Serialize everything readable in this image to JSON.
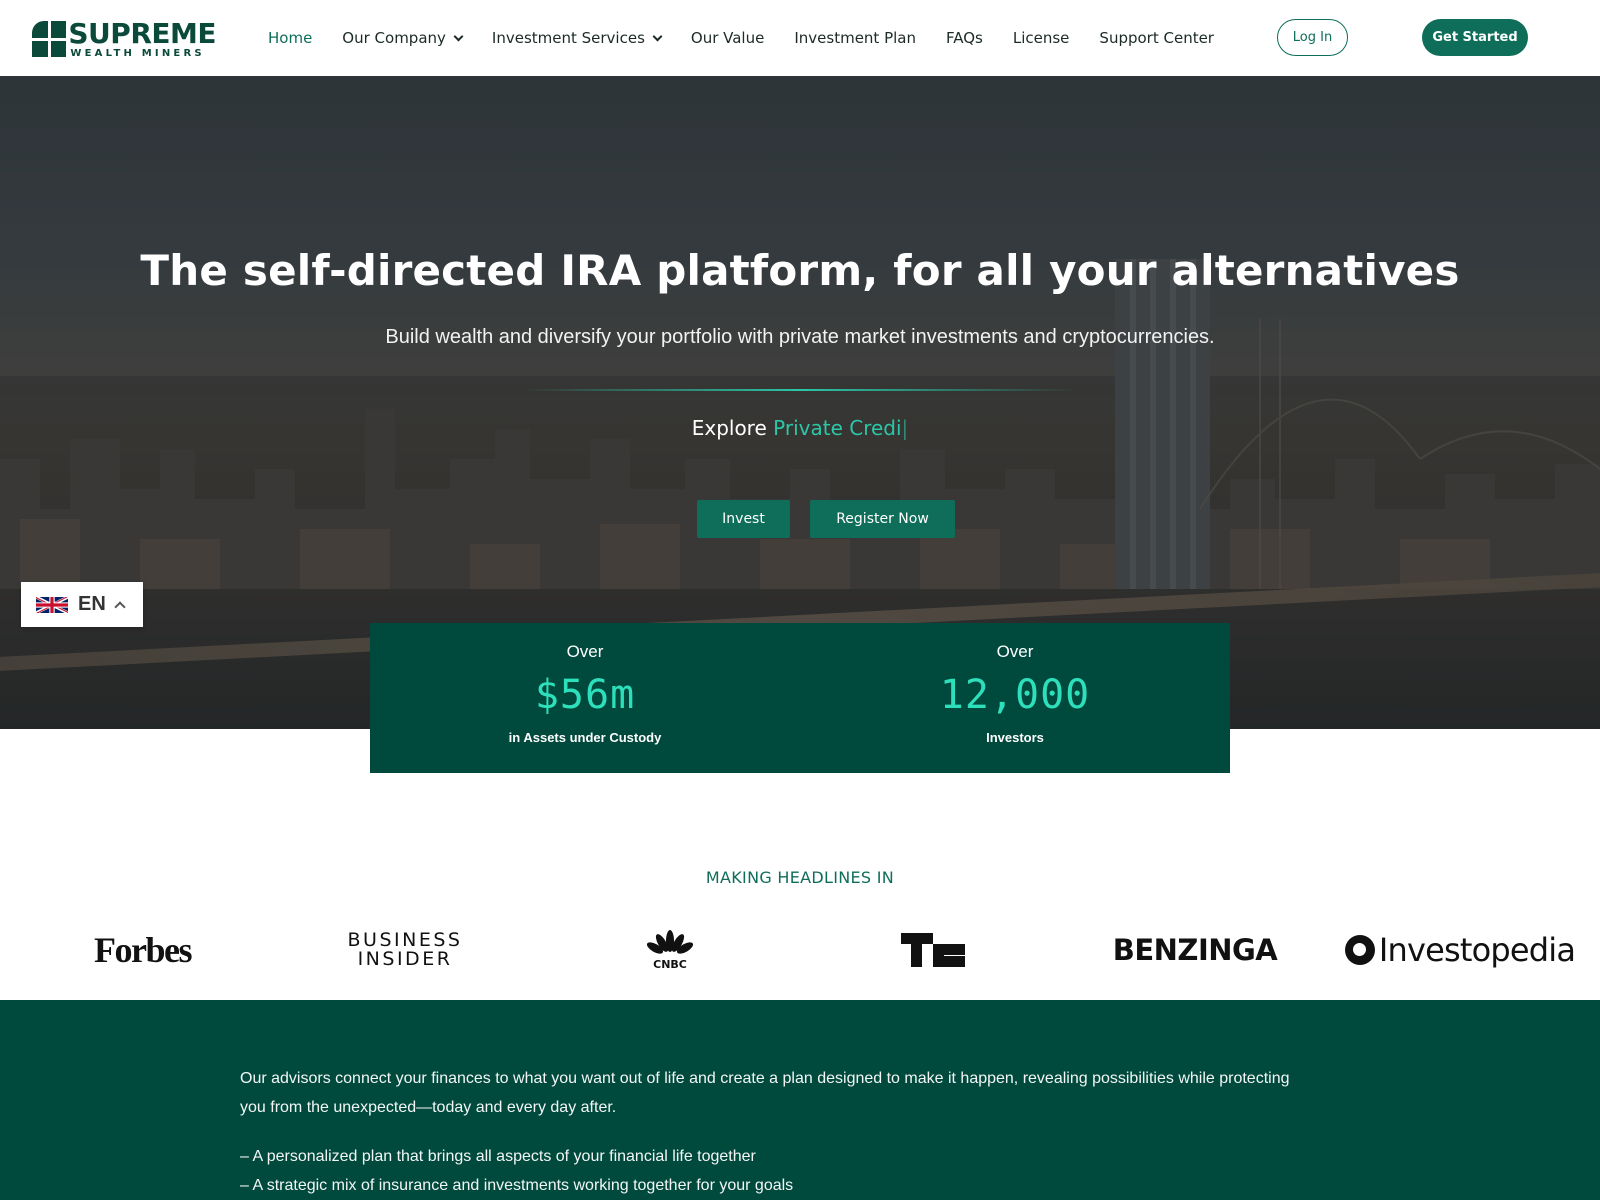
{
  "brand": {
    "name": "SUPREME",
    "tagline": "WEALTH MINERS",
    "primary_color": "#0e6e5a",
    "dark_color": "#004a3d",
    "accent_color": "#2de0bb"
  },
  "nav": {
    "items": [
      {
        "label": "Home",
        "active": true
      },
      {
        "label": "Our Company",
        "dropdown": true
      },
      {
        "label": "Investment Services",
        "dropdown": true
      },
      {
        "label": "Our Value"
      },
      {
        "label": "Investment Plan"
      },
      {
        "label": "FAQs"
      },
      {
        "label": "License"
      },
      {
        "label": "Support Center"
      }
    ],
    "login_label": "Log In",
    "cta_label": "Get Started"
  },
  "hero": {
    "title": "The self-directed IRA platform, for all your alternatives",
    "subtitle": "Build wealth and diversify your portfolio with private market investments and cryptocurrencies.",
    "explore_prefix": "Explore",
    "explore_typed": "Private Credi",
    "caret": "|",
    "invest_label": "Invest",
    "register_label": "Register Now"
  },
  "language": {
    "code": "EN",
    "flag_icon": "uk-flag-icon"
  },
  "stats": [
    {
      "prefix": "Over",
      "value": "$56m",
      "caption": "in Assets under Custody"
    },
    {
      "prefix": "Over",
      "value": "12,000",
      "caption": "Investors"
    }
  ],
  "headlines": {
    "title": "MAKING HEADLINES IN",
    "outlets": {
      "forbes": "Forbes",
      "business_insider_line1": "BUSINESS",
      "business_insider_line2": "INSIDER",
      "cnbc": "CNBC",
      "techcrunch": "TC",
      "benzinga": "BENZINGA",
      "investopedia": "Investopedia"
    }
  },
  "about": {
    "paragraph": "Our advisors connect your finances to what you want out of life and create a plan designed to make it happen, revealing possibilities while protecting you from the unexpected—today and every day after.",
    "points": [
      "– A personalized plan that brings all aspects of your financial life together",
      "– A strategic mix of insurance and investments working together for your goals"
    ]
  }
}
